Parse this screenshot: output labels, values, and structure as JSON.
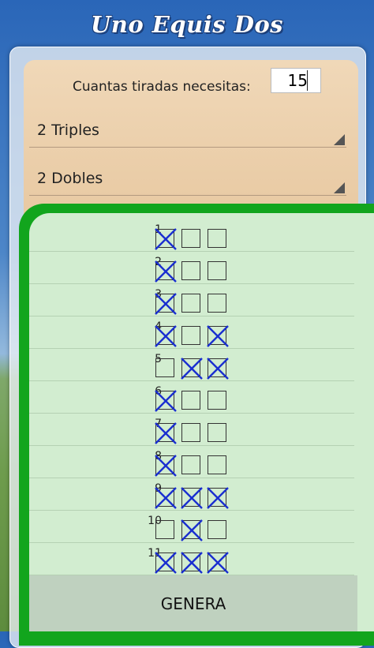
{
  "app": {
    "title": "Uno Equis Dos"
  },
  "config": {
    "count_label": "Cuantas tiradas necesitas:",
    "count_value": "15",
    "triples_selected": "2 Triples",
    "dobles_selected": "2 Dobles"
  },
  "rows": [
    {
      "num": "1",
      "marks": [
        true,
        false,
        false
      ]
    },
    {
      "num": "2",
      "marks": [
        true,
        false,
        false
      ]
    },
    {
      "num": "3",
      "marks": [
        true,
        false,
        false
      ]
    },
    {
      "num": "4",
      "marks": [
        true,
        false,
        true
      ]
    },
    {
      "num": "5",
      "marks": [
        false,
        true,
        true
      ]
    },
    {
      "num": "6",
      "marks": [
        true,
        false,
        false
      ]
    },
    {
      "num": "7",
      "marks": [
        true,
        false,
        false
      ]
    },
    {
      "num": "8",
      "marks": [
        true,
        false,
        false
      ]
    },
    {
      "num": "9",
      "marks": [
        true,
        true,
        true
      ]
    },
    {
      "num": "10",
      "marks": [
        false,
        true,
        false
      ]
    },
    {
      "num": "11",
      "marks": [
        true,
        true,
        true
      ]
    }
  ],
  "actions": {
    "genera_label": "GENERA"
  },
  "colors": {
    "accent_green": "#12a51d",
    "mark_blue": "#1a2fd0"
  }
}
